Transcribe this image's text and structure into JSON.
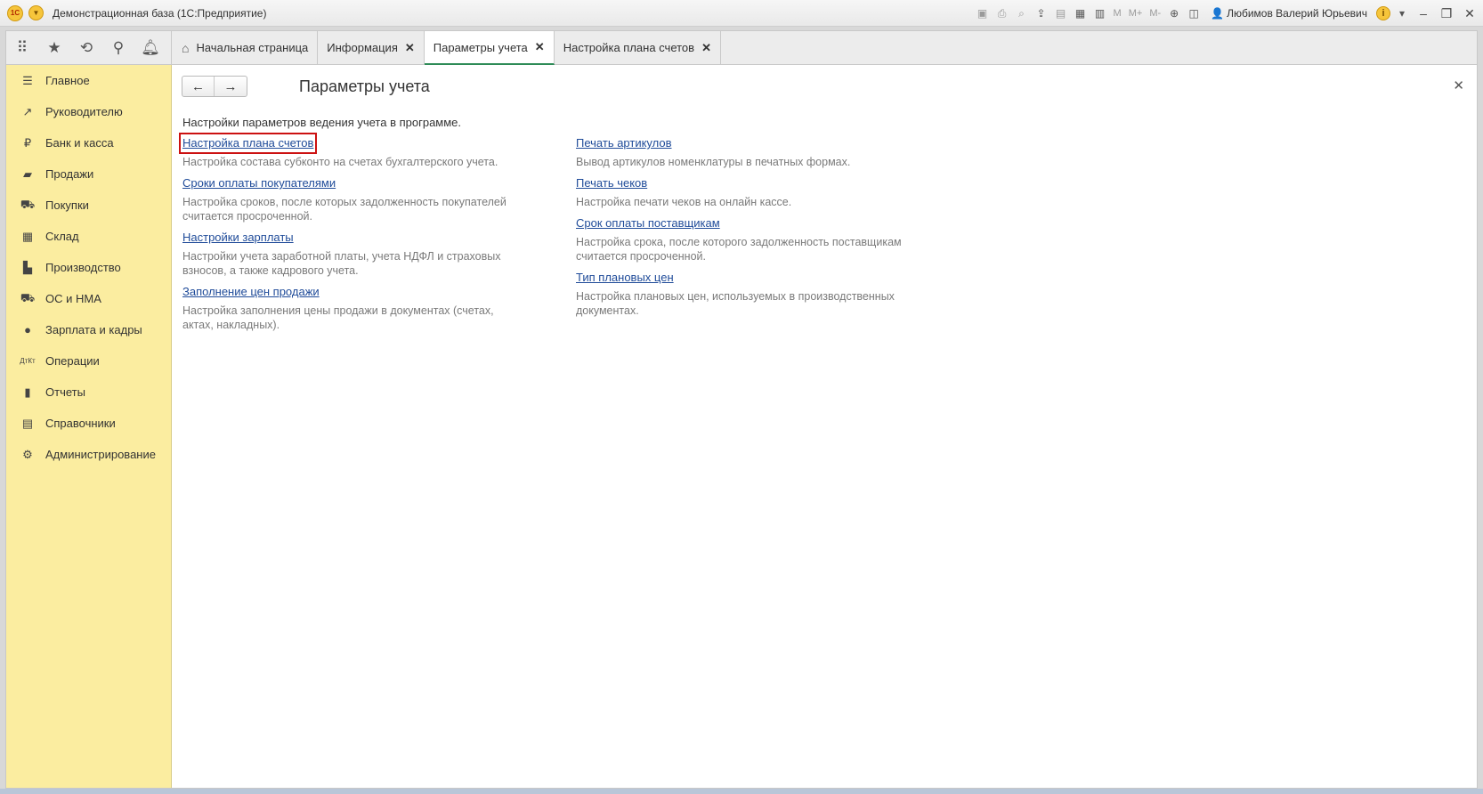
{
  "app": {
    "title": "Демонстрационная база  (1С:Предприятие)",
    "logo_text": "1С",
    "user": "Любимов Валерий Юрьевич",
    "toolbar_text": [
      "M",
      "M+",
      "M-"
    ]
  },
  "tabs": [
    {
      "label": "Начальная страница",
      "closable": false,
      "active": false
    },
    {
      "label": "Информация",
      "closable": true,
      "active": false
    },
    {
      "label": "Параметры учета",
      "closable": true,
      "active": true
    },
    {
      "label": "Настройка плана счетов",
      "closable": true,
      "active": false
    }
  ],
  "sidebar": {
    "items": [
      {
        "label": "Главное",
        "icon": "menu-icon"
      },
      {
        "label": "Руководителю",
        "icon": "trend-icon"
      },
      {
        "label": "Банк и касса",
        "icon": "ruble-icon"
      },
      {
        "label": "Продажи",
        "icon": "bag-icon"
      },
      {
        "label": "Покупки",
        "icon": "cart-icon"
      },
      {
        "label": "Склад",
        "icon": "warehouse-icon"
      },
      {
        "label": "Производство",
        "icon": "factory-icon"
      },
      {
        "label": "ОС и НМА",
        "icon": "truck-icon"
      },
      {
        "label": "Зарплата и кадры",
        "icon": "person-icon"
      },
      {
        "label": "Операции",
        "icon": "dt-kt-icon"
      },
      {
        "label": "Отчеты",
        "icon": "bar-chart-icon"
      },
      {
        "label": "Справочники",
        "icon": "book-icon"
      },
      {
        "label": "Администрирование",
        "icon": "gear-icon"
      }
    ]
  },
  "main": {
    "title": "Параметры учета",
    "intro": "Настройки параметров ведения учета в программе.",
    "left": [
      {
        "link": "Настройка плана счетов",
        "desc": "Настройка состава субконто на счетах бухгалтерского учета."
      },
      {
        "link": "Сроки оплаты покупателями",
        "desc": "Настройка сроков, после которых задолженность покупателей считается просроченной."
      },
      {
        "link": "Настройки зарплаты",
        "desc": "Настройки учета заработной платы, учета НДФЛ и страховых взносов, а также кадрового учета."
      },
      {
        "link": "Заполнение цен продажи",
        "desc": "Настройка заполнения цены продажи в документах (счетах, актах, накладных)."
      }
    ],
    "right": [
      {
        "link": "Печать артикулов",
        "desc": "Вывод артикулов номенклатуры в печатных формах."
      },
      {
        "link": "Печать чеков",
        "desc": "Настройка печати чеков на онлайн кассе."
      },
      {
        "link": "Срок оплаты поставщикам",
        "desc": "Настройка срока, после которого задолженность поставщикам считается просроченной."
      },
      {
        "link": "Тип плановых цен",
        "desc": "Настройка плановых цен, используемых в производственных документах."
      }
    ]
  },
  "colors": {
    "sidebar_bg": "#fbeda0",
    "link": "#1f4b99",
    "highlight": "#cc1111",
    "active_tab": "#2e8b57"
  }
}
